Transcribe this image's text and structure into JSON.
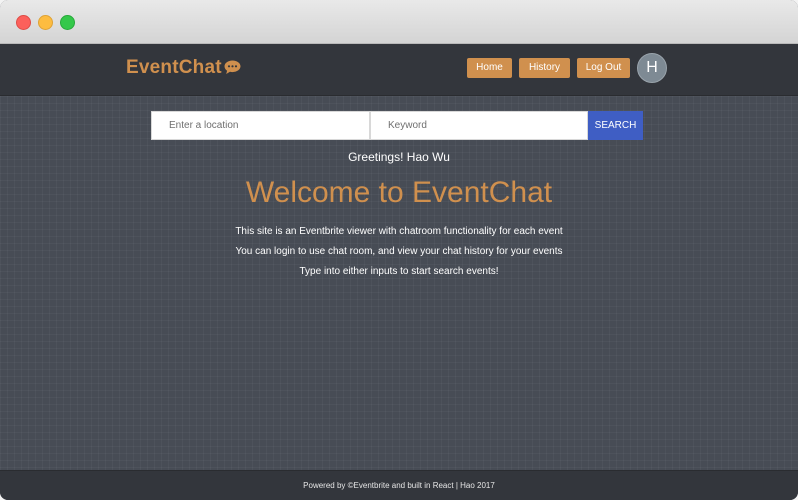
{
  "navbar": {
    "brand": "EventChat",
    "brand_icon": "chat-bubble-icon",
    "home_label": "Home",
    "history_label": "History",
    "logout_label": "Log Out",
    "avatar_initial": "H"
  },
  "search": {
    "location_placeholder": "Enter a location",
    "keyword_placeholder": "Keyword",
    "button_label": "SEARCH"
  },
  "main": {
    "greeting": "Greetings! Hao Wu",
    "welcome_title": "Welcome to EventChat",
    "descriptions": [
      "This site is an Eventbrite viewer with chatroom functionality for each event",
      "You can login to use chat room, and view your chat history for your events",
      "Type into either inputs to start search events!"
    ]
  },
  "footer": {
    "text": "Powered by ©Eventbrite and built in React | Hao 2017"
  },
  "colors": {
    "accent": "#d0904e",
    "search_button": "#3f5ec4",
    "navbar_bg": "#33363c",
    "content_bg": "#474c55"
  }
}
